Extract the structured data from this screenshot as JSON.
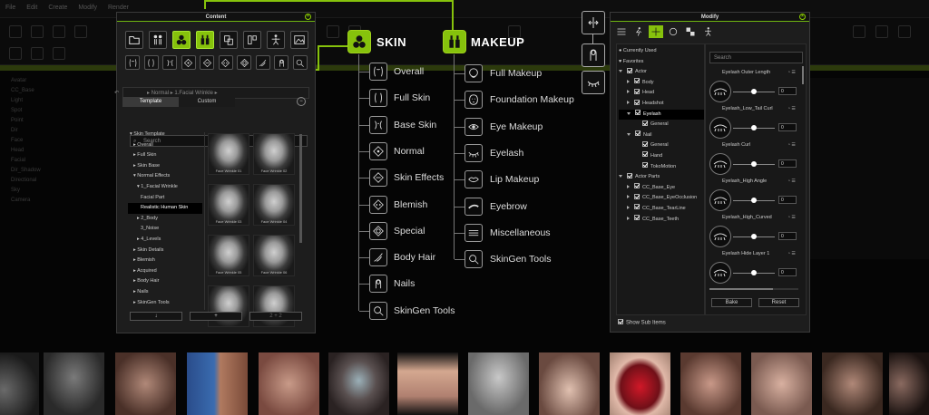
{
  "background_app": {
    "menu": [
      "File",
      "Edit",
      "Create",
      "Modify",
      "Render"
    ],
    "left_tree": [
      "Avatar",
      "CC_Base",
      "Light",
      "Spot",
      "Point",
      "Dir",
      "Face",
      "Head",
      "Facial",
      "Dir_Shadow",
      "Directional",
      "Sky",
      "Camera"
    ]
  },
  "content_panel": {
    "title": "Content",
    "category_buttons": [
      "folder-icon",
      "avatar-icon",
      "skin-icon",
      "makeup-icon",
      "clothes-icon",
      "accessory-icon",
      "motion-icon",
      "scene-icon"
    ],
    "sub_buttons": [
      "overall-icon",
      "full-skin-icon",
      "base-skin-icon",
      "normal-icon",
      "skin-effects-icon",
      "blemish-icon",
      "special-icon",
      "body-hair-icon",
      "nails-icon",
      "skingen-icon"
    ],
    "breadcrumb": [
      "Normal",
      "1.Facial Wrinkle"
    ],
    "tabs": [
      "Template",
      "Custom"
    ],
    "search_placeholder": "Search",
    "tree": [
      "Skin Template",
      "Overall",
      "Full Skin",
      "Skin Base",
      "Normal Effects",
      "1_Facial Wrinkle",
      "Facial Part",
      "Realistic Human Skin",
      "2_Body",
      "3_Noise",
      "4_Levels",
      "Skin Details",
      "Blemish",
      "Acquired",
      "Body Hair",
      "Nails",
      "SkinGen Tools"
    ],
    "thumbs": [
      "Face Wrinkle 01",
      "Face Wrinkle 02",
      "Face Wrinkle 03",
      "Face Wrinkle 04",
      "Face Wrinkle 05",
      "Face Wrinkle 06",
      "",
      ""
    ],
    "footer_buttons": [
      "↓",
      "+",
      "2 + 2"
    ]
  },
  "skin": {
    "header": "SKIN",
    "items": [
      "Overall",
      "Full Skin",
      "Base Skin",
      "Normal",
      "Skin Effects",
      "Blemish",
      "Special",
      "Body Hair",
      "Nails",
      "SkinGen Tools"
    ]
  },
  "makeup": {
    "header": "MAKEUP",
    "items": [
      "Full Makeup",
      "Foundation Makeup",
      "Eye Makeup",
      "Eyelash",
      "Lip Makeup",
      "Eyebrow",
      "Miscellaneous",
      "SkinGen Tools"
    ]
  },
  "modify_panel": {
    "title": "Modify",
    "tree": [
      {
        "label": "Currently Used",
        "kind": "dot",
        "indent": 0
      },
      {
        "label": "Favorites",
        "kind": "heart",
        "indent": 0
      },
      {
        "label": "Actor",
        "kind": "open",
        "indent": 0
      },
      {
        "label": "Body",
        "kind": "closed",
        "indent": 1
      },
      {
        "label": "Head",
        "kind": "closed",
        "indent": 1
      },
      {
        "label": "Headshot",
        "kind": "closed",
        "indent": 1
      },
      {
        "label": "Eyelash",
        "kind": "open",
        "indent": 1,
        "hl": true
      },
      {
        "label": "General",
        "kind": "leaf",
        "indent": 2
      },
      {
        "label": "Nail",
        "kind": "open",
        "indent": 1
      },
      {
        "label": "General",
        "kind": "leaf",
        "indent": 2
      },
      {
        "label": "Hand",
        "kind": "leaf",
        "indent": 2
      },
      {
        "label": "TokoMotion",
        "kind": "leaf",
        "indent": 2
      },
      {
        "label": "Actor Parts",
        "kind": "open",
        "indent": 0
      },
      {
        "label": "CC_Base_Eye",
        "kind": "closed",
        "indent": 1
      },
      {
        "label": "CC_Base_EyeOcclusion",
        "kind": "closed",
        "indent": 1
      },
      {
        "label": "CC_Base_TearLine",
        "kind": "closed",
        "indent": 1
      },
      {
        "label": "CC_Base_Teeth",
        "kind": "closed",
        "indent": 1
      }
    ],
    "search_placeholder": "Search",
    "sliders": [
      {
        "name": "Eyelash Outer Length",
        "value": "0",
        "pos": 0.5
      },
      {
        "name": "Eyelash_Low_Tail Curl",
        "value": "0",
        "pos": 0.5
      },
      {
        "name": "Eyelash Curl",
        "value": "0",
        "pos": 0.5
      },
      {
        "name": "Eyelash_High Angle",
        "value": "0",
        "pos": 0.5
      },
      {
        "name": "Eyelash_High_Curved",
        "value": "0",
        "pos": 0.5
      },
      {
        "name": "Eyelash Hide Layer 1",
        "value": "0",
        "pos": 0.5
      }
    ],
    "bake_label": "Bake",
    "reset_label": "Reset",
    "show_sub_items": "Show Sub Items"
  },
  "colors": {
    "accent": "#86c20c",
    "panel": "#1d1d1d"
  }
}
